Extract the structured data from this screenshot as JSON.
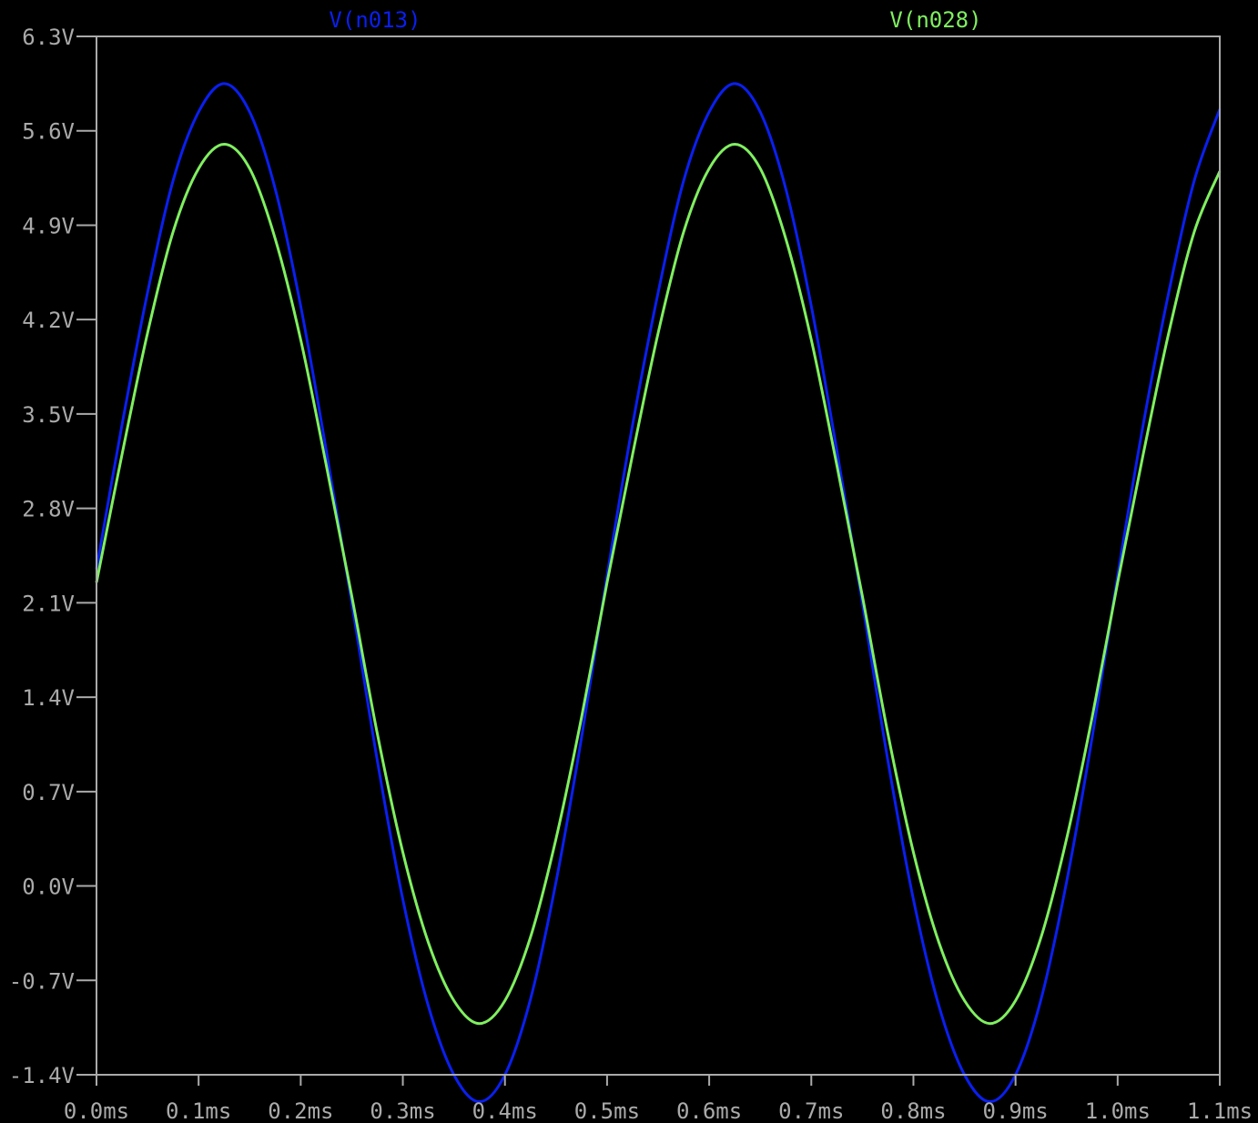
{
  "chart_data": {
    "type": "line",
    "title": "",
    "xlabel": "",
    "ylabel": "",
    "xlim": [
      0.0,
      1.1
    ],
    "ylim": [
      -1.4,
      6.3
    ],
    "x_unit": "ms",
    "y_unit": "V",
    "grid": false,
    "legend_placement": "top",
    "x_ticks": [
      "0.0ms",
      "0.1ms",
      "0.2ms",
      "0.3ms",
      "0.4ms",
      "0.5ms",
      "0.6ms",
      "0.7ms",
      "0.8ms",
      "0.9ms",
      "1.0ms",
      "1.1ms"
    ],
    "y_ticks": [
      "6.3V",
      "5.6V",
      "4.9V",
      "4.2V",
      "3.5V",
      "2.8V",
      "2.1V",
      "1.4V",
      "0.7V",
      "0.0V",
      "-0.7V",
      "-1.4V"
    ],
    "colors": {
      "background": "#000000",
      "frame": "#aaaaaa",
      "tick_text": "#aaaaaa"
    },
    "series": [
      {
        "name": "V(n013)",
        "color": "#0a1ff0",
        "x": [
          0.0,
          0.025,
          0.05,
          0.075,
          0.1,
          0.125,
          0.15,
          0.175,
          0.2,
          0.225,
          0.25,
          0.275,
          0.3,
          0.325,
          0.35,
          0.375,
          0.4,
          0.425,
          0.45,
          0.475,
          0.5,
          0.525,
          0.55,
          0.575,
          0.6,
          0.625,
          0.65,
          0.675,
          0.7,
          0.725,
          0.75,
          0.775,
          0.8,
          0.825,
          0.85,
          0.875,
          0.9,
          0.925,
          0.95,
          0.975,
          1.0,
          1.025,
          1.05,
          1.075,
          1.1
        ],
        "y": [
          2.35,
          3.42,
          4.4,
          5.23,
          5.74,
          5.95,
          5.74,
          5.17,
          4.3,
          3.23,
          2.1,
          0.93,
          -0.1,
          -0.89,
          -1.4,
          -1.6,
          -1.4,
          -0.84,
          0.03,
          1.1,
          2.3,
          3.42,
          4.4,
          5.23,
          5.74,
          5.95,
          5.74,
          5.17,
          4.3,
          3.23,
          2.1,
          0.93,
          -0.1,
          -0.89,
          -1.4,
          -1.6,
          -1.4,
          -0.84,
          0.03,
          1.1,
          2.3,
          3.42,
          4.4,
          5.23,
          5.76
        ]
      },
      {
        "name": "V(n028)",
        "color": "#80f060",
        "x": [
          0.0,
          0.025,
          0.05,
          0.075,
          0.1,
          0.125,
          0.15,
          0.175,
          0.2,
          0.225,
          0.25,
          0.275,
          0.3,
          0.325,
          0.35,
          0.375,
          0.4,
          0.425,
          0.45,
          0.475,
          0.5,
          0.525,
          0.55,
          0.575,
          0.6,
          0.625,
          0.65,
          0.675,
          0.7,
          0.725,
          0.75,
          0.775,
          0.8,
          0.825,
          0.85,
          0.875,
          0.9,
          0.925,
          0.95,
          0.975,
          1.0,
          1.025,
          1.05,
          1.075,
          1.1
        ],
        "y": [
          2.25,
          3.2,
          4.1,
          4.85,
          5.32,
          5.5,
          5.32,
          4.8,
          4.05,
          3.12,
          2.15,
          1.13,
          0.25,
          -0.42,
          -0.85,
          -1.02,
          -0.85,
          -0.38,
          0.35,
          1.25,
          2.25,
          3.2,
          4.1,
          4.85,
          5.32,
          5.5,
          5.32,
          4.8,
          4.05,
          3.12,
          2.15,
          1.13,
          0.25,
          -0.42,
          -0.85,
          -1.02,
          -0.85,
          -0.38,
          0.35,
          1.25,
          2.25,
          3.2,
          4.1,
          4.85,
          5.3
        ]
      }
    ]
  }
}
